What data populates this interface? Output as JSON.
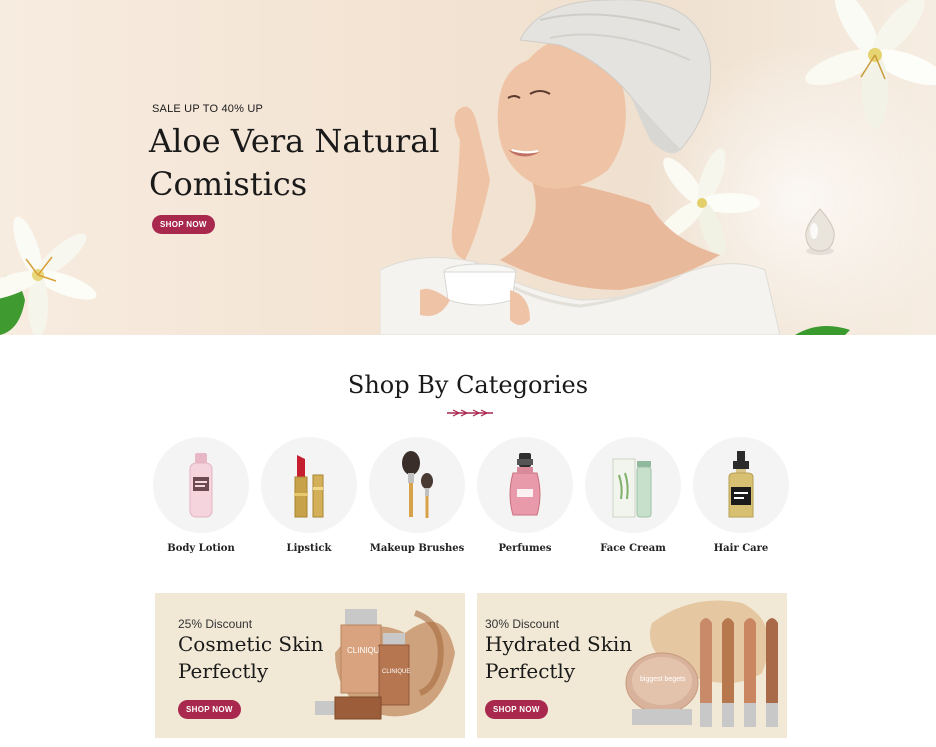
{
  "hero": {
    "eyebrow": "SALE UP TO 40% UP",
    "title_line1": "Aloe Vera Natural",
    "title_line2": "Comistics",
    "button": "SHOP NOW"
  },
  "categories": {
    "title": "Shop By Categories",
    "items": [
      {
        "label": "Body Lotion",
        "icon": "lotion-bottle-icon"
      },
      {
        "label": "Lipstick",
        "icon": "lipstick-icon"
      },
      {
        "label": "Makeup Brushes",
        "icon": "makeup-brush-icon"
      },
      {
        "label": "Perfumes",
        "icon": "perfume-bottle-icon"
      },
      {
        "label": "Face Cream",
        "icon": "face-cream-icon"
      },
      {
        "label": "Hair Care",
        "icon": "spray-bottle-icon"
      }
    ]
  },
  "promos": [
    {
      "discount": "25% Discount",
      "title_line1": "Cosmetic Skin",
      "title_line2": "Perfectly",
      "button": "SHOP NOW",
      "brand": "CLINIQUE"
    },
    {
      "discount": "30% Discount",
      "title_line1": "Hydrated Skin",
      "title_line2": "Perfectly",
      "button": "SHOP NOW",
      "brand": "biggest begets"
    }
  ],
  "colors": {
    "accent": "#a8284e",
    "hero_bg": "#f3e3d2",
    "promo_bg": "#f1e9d6",
    "circle_bg": "#f4f4f4"
  }
}
